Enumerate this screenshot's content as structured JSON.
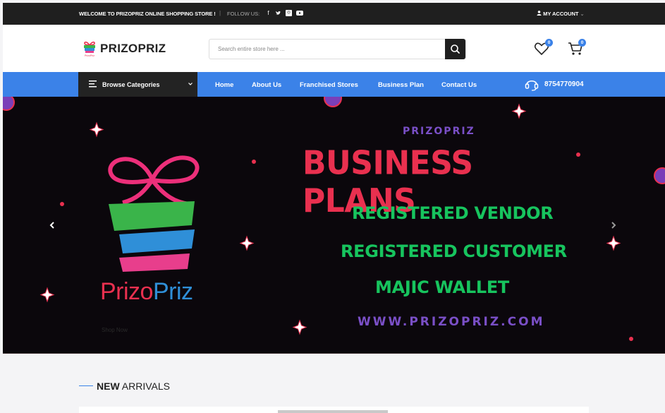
{
  "topbar": {
    "welcome": "WELCOME TO PRIZOPRIZ ONLINE SHOPPING STORE !",
    "follow_label": "FOLLOW US:",
    "social_icons": [
      "facebook-icon",
      "twitter-icon",
      "instagram-icon",
      "youtube-icon"
    ],
    "account_label": "MY ACCOUNT"
  },
  "header": {
    "logo_text": "PRIZOPRIZ",
    "search_placeholder": "Search entire store here ...",
    "wishlist_count": "0",
    "cart_count": "0"
  },
  "nav": {
    "browse_label": "Browse Categories",
    "links": [
      "Home",
      "About Us",
      "Franchised Stores",
      "Business Plan",
      "Contact Us"
    ],
    "phone": "8754770904"
  },
  "banner": {
    "brand_small": "PRIZOPRIZ",
    "title": "BUSINESS PLANS",
    "lines": [
      "REGISTERED VENDOR",
      "REGISTERED CUSTOMER",
      "MAJIC WALLET"
    ],
    "url": "WWW.PRIZOPRIZ.COM",
    "logo_word_a": "Prizo",
    "logo_word_b": "Priz",
    "shop_now": "Shop Now"
  },
  "section": {
    "title_bold": "NEW",
    "title_rest": " ARRIVALS"
  },
  "colors": {
    "accent": "#3b82e8",
    "dark": "#1f1f1f",
    "banner_bg": "#0b070c",
    "title_red": "#e9304f",
    "green": "#17c45e",
    "purple": "#7a4fc7"
  }
}
